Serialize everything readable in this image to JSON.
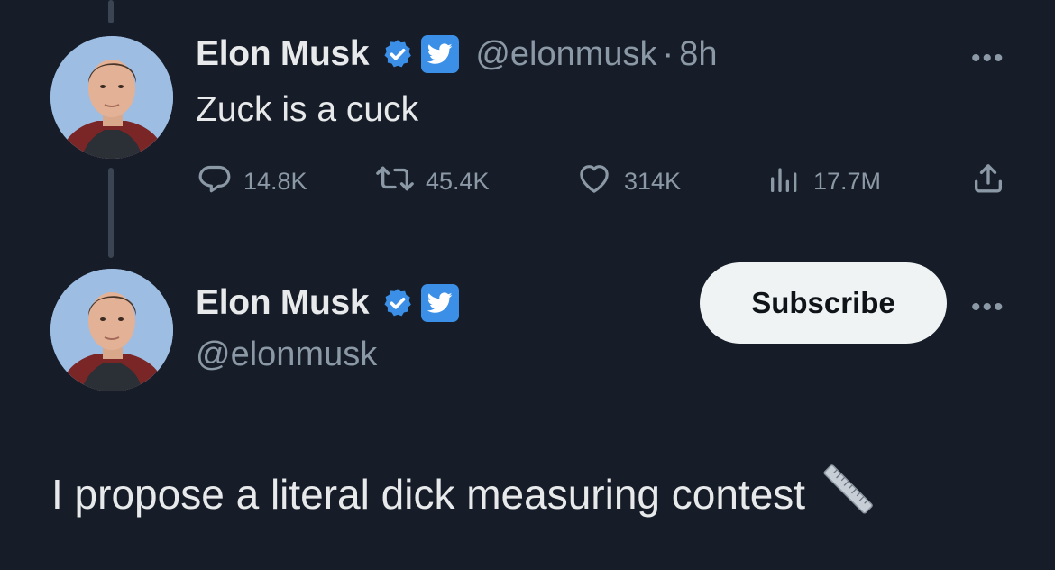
{
  "tweet1": {
    "name": "Elon Musk",
    "handle": "@elonmusk",
    "separator": "·",
    "time": "8h",
    "text": "Zuck is a cuck",
    "more_label": "•••",
    "actions": {
      "replies": "14.8K",
      "retweets": "45.4K",
      "likes": "314K",
      "views": "17.7M"
    }
  },
  "tweet2": {
    "name": "Elon Musk",
    "handle": "@elonmusk",
    "subscribe_label": "Subscribe",
    "more_label": "•••",
    "text": "I propose a literal dick measuring contest"
  },
  "icons": {
    "verified": "verified-check-icon",
    "twitter": "twitter-bird-icon",
    "reply": "reply-icon",
    "retweet": "retweet-icon",
    "like": "heart-icon",
    "views": "views-bar-icon",
    "share": "share-icon",
    "ruler": "straight-ruler-emoji"
  },
  "colors": {
    "background": "#161d28",
    "verified_blue": "#3b8fe6",
    "muted_text": "#8b98a5",
    "primary_text": "#e7e9ea",
    "subscribe_bg": "#eff3f4"
  }
}
